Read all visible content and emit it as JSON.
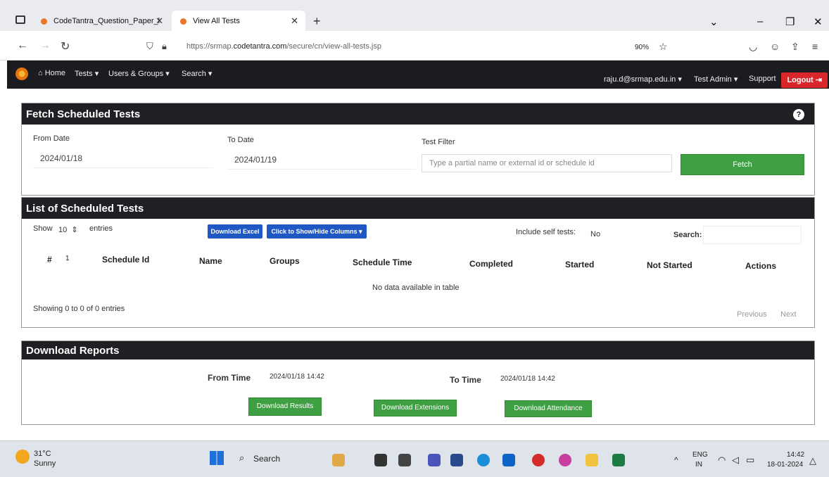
{
  "browser": {
    "tabs": [
      {
        "label": "CodeTantra_Question_Paper_l",
        "close": "✕"
      },
      {
        "label": "View All Tests",
        "close": "✕"
      }
    ],
    "new_tab": "+",
    "window_controls": {
      "dropdown": "⌄",
      "minimize": "–",
      "restore": "❐",
      "close": "✕"
    },
    "nav": {
      "back": "←",
      "forward": "→",
      "reload": "↻"
    },
    "url_prefix": "https://srmap.",
    "url_domain": "codetantra.com",
    "url_suffix": "/secure/cn/view-all-tests.jsp",
    "zoom": "90%"
  },
  "app": {
    "menu": {
      "home": "Home",
      "tests": "Tests",
      "users_groups": "Users & Groups",
      "search": "Search"
    },
    "user_email": "raju.d@srmap.edu.in",
    "role": "Test Admin",
    "support": "Support",
    "logout": "Logout"
  },
  "fetch_panel": {
    "title": "Fetch Scheduled Tests",
    "from_date_label": "From Date",
    "from_date_value": "2024/01/18",
    "to_date_label": "To Date",
    "to_date_value": "2024/01/19",
    "test_filter_label": "Test Filter",
    "test_filter_placeholder": "Type a partial name or external id or schedule id",
    "fetch_button": "Fetch"
  },
  "list_panel": {
    "title": "List of Scheduled Tests",
    "show_label": "Show",
    "entries_value": "10",
    "entries_label": "entries",
    "download_excel": "Download Excel",
    "show_hide_columns": "Click to Show/Hide Columns",
    "include_self_label": "Include self tests:",
    "include_self_value": "No",
    "search_label": "Search:",
    "columns": [
      "#",
      "Schedule Id",
      "Name",
      "Groups",
      "Schedule Time",
      "Completed",
      "Started",
      "Not Started",
      "Actions"
    ],
    "empty_message": "No data available in table",
    "info": "Showing 0 to 0 of 0 entries",
    "previous": "Previous",
    "next": "Next"
  },
  "reports_panel": {
    "title": "Download Reports",
    "from_time_label": "From Time",
    "from_time_value": "2024/01/18 14:42",
    "to_time_label": "To Time",
    "to_time_value": "2024/01/18 14:42",
    "download_results": "Download Results",
    "download_extensions": "Download Extensions",
    "download_attendance": "Download Attendance"
  },
  "taskbar": {
    "weather_temp": "31°C",
    "weather_desc": "Sunny",
    "search": "Search",
    "lang": "ENG",
    "region": "IN",
    "time": "14:42",
    "date": "18-01-2024"
  },
  "colors": {
    "header_dark": "#1b1c20",
    "panel_head": "#1f2024",
    "logout_red": "#d9262b",
    "fetch_green": "#3fa043",
    "download_blue": "#1f57c4"
  }
}
